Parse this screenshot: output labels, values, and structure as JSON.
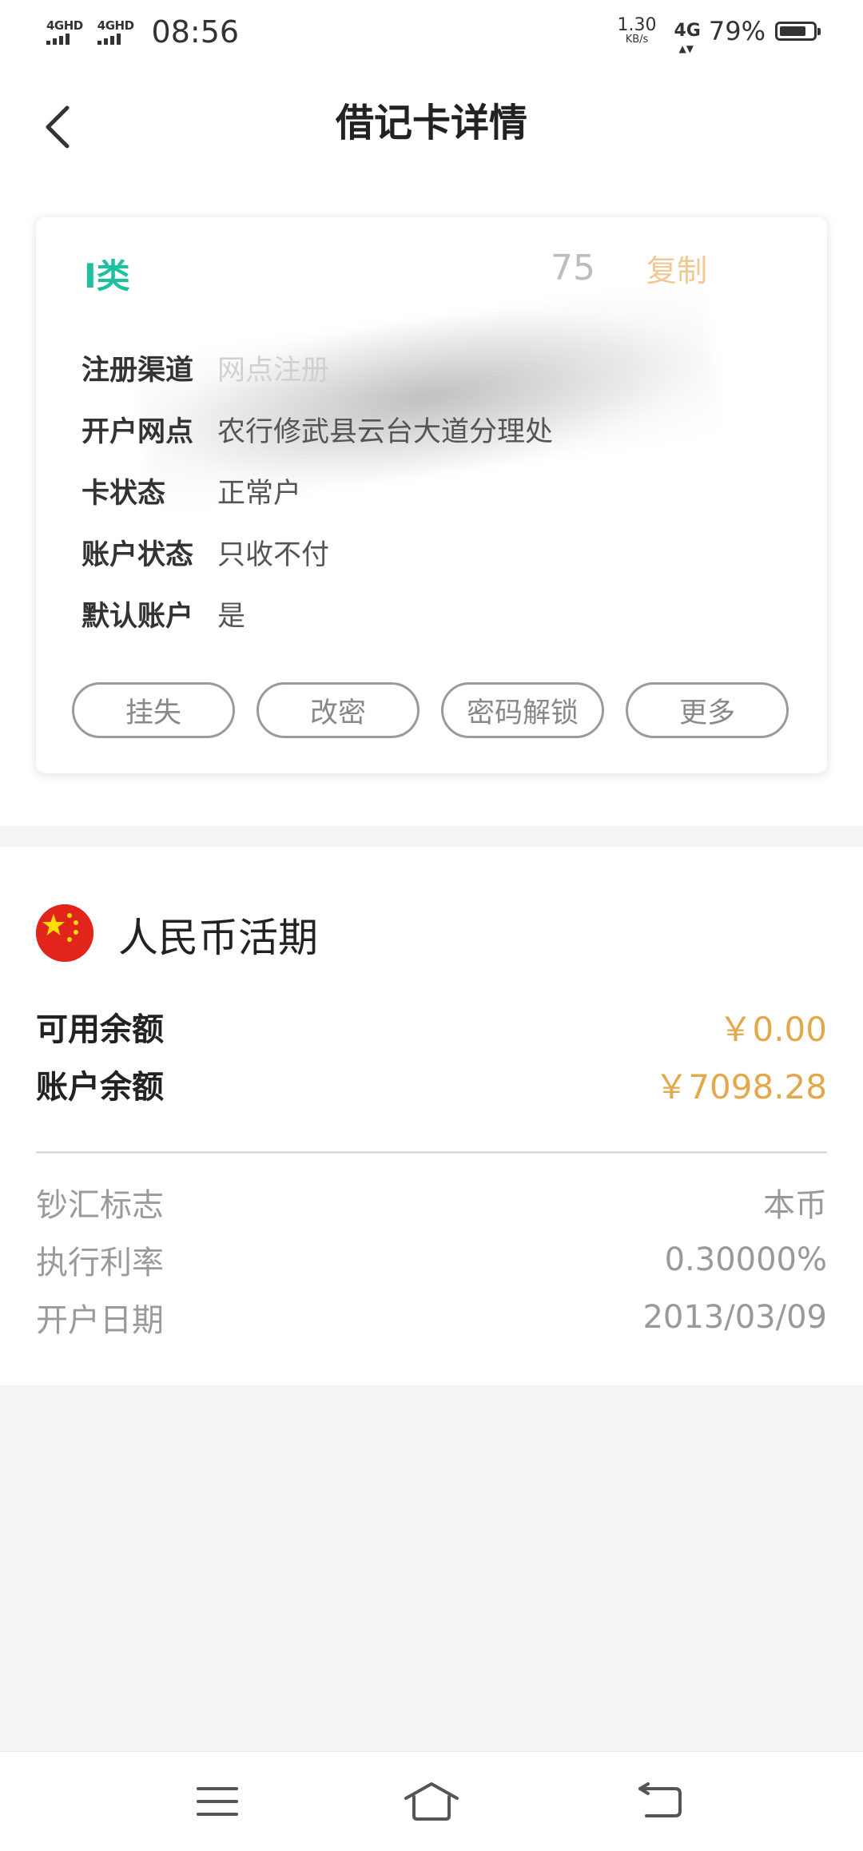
{
  "status_bar": {
    "sim1": "4GHD",
    "sim2": "4GHD",
    "time": "08:56",
    "speed_value": "1.30",
    "speed_unit": "KB/s",
    "network": "4G",
    "battery_pct": "79%",
    "battery_level": 0.79
  },
  "header": {
    "title": "借记卡详情",
    "back_icon": "chevron-left-icon"
  },
  "card": {
    "type_label": "I类",
    "number_tail": "75",
    "copy_label": "复制",
    "rows": [
      {
        "label": "注册渠道",
        "value": "网点注册"
      },
      {
        "label": "开户网点",
        "value": "农行修武县云台大道分理处"
      },
      {
        "label": "卡状态",
        "value": "正常户"
      },
      {
        "label": "账户状态",
        "value": "只收不付"
      },
      {
        "label": "默认账户",
        "value": "是"
      }
    ],
    "actions": [
      "挂失",
      "改密",
      "密码解锁",
      "更多"
    ]
  },
  "account": {
    "flag_icon": "china-flag-icon",
    "currency_name": "人民币活期",
    "available_label": "可用余额",
    "available_value": "￥0.00",
    "balance_label": "账户余额",
    "balance_value": "￥7098.28",
    "meta": [
      {
        "label": "钞汇标志",
        "value": "本币"
      },
      {
        "label": "执行利率",
        "value": "0.30000%"
      },
      {
        "label": "开户日期",
        "value": "2013/03/09"
      }
    ]
  },
  "colors": {
    "accent_green": "#1fbf9f",
    "amount_gold": "#e3a84b",
    "copy_light": "#f0c890"
  },
  "nav_bar": {
    "menu_icon": "menu-icon",
    "home_icon": "home-icon",
    "back_icon": "back-return-icon"
  }
}
